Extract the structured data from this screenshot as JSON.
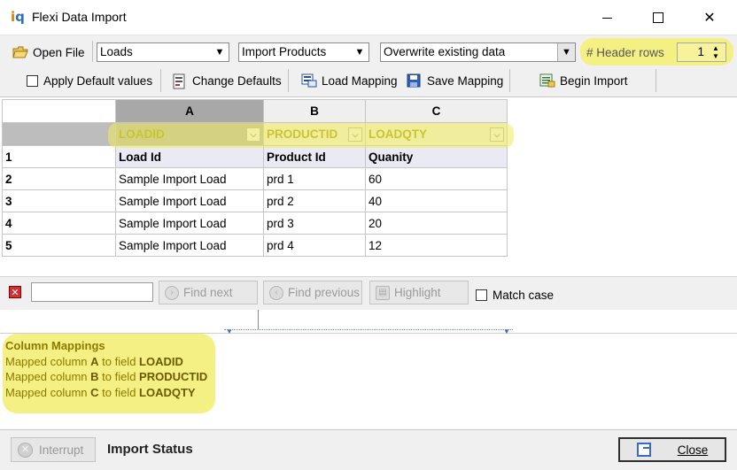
{
  "window": {
    "title": "Flexi Data Import",
    "app_icon_text_1": "i",
    "app_icon_text_2": "q",
    "minimize": "–",
    "close": "✕"
  },
  "toolbar": {
    "open_file_label": "Open File",
    "target_combo_value": "Loads",
    "mapping_combo_value": "Import Products",
    "mode_combo_value": "Overwrite existing data",
    "header_rows_label": "# Header rows",
    "header_rows_value": "1",
    "apply_defaults_label": "Apply Default values",
    "apply_defaults_checked": false,
    "change_defaults_label": "Change Defaults",
    "load_mapping_label": "Load Mapping",
    "save_mapping_label": "Save Mapping",
    "begin_import_label": "Begin Import"
  },
  "grid": {
    "column_letters": [
      "A",
      "B",
      "C"
    ],
    "field_mappings": [
      "LOADID",
      "PRODUCTID",
      "LOADQTY"
    ],
    "dropdown_glyph": "⌵",
    "rows": [
      {
        "num": "1",
        "cells": [
          "Load Id",
          "Product Id",
          "Quanity"
        ]
      },
      {
        "num": "2",
        "cells": [
          "Sample Import Load",
          "prd 1",
          "60"
        ]
      },
      {
        "num": "3",
        "cells": [
          "Sample Import Load",
          "prd 2",
          "40"
        ]
      },
      {
        "num": "4",
        "cells": [
          "Sample Import Load",
          "prd 3",
          "20"
        ]
      },
      {
        "num": "5",
        "cells": [
          "Sample Import Load",
          "prd 4",
          "12"
        ]
      }
    ]
  },
  "search": {
    "error_glyph": "✕",
    "find_next_label": "Find next",
    "find_previous_label": "Find previous",
    "highlight_label": "Highlight",
    "match_case_label": "Match case"
  },
  "log": {
    "title": "Column Mappings",
    "lines": [
      {
        "prefix": "Mapped column ",
        "column": "A",
        "mid": " to field ",
        "field": "LOADID"
      },
      {
        "prefix": "Mapped column ",
        "column": "B",
        "mid": " to field ",
        "field": "PRODUCTID"
      },
      {
        "prefix": "Mapped column ",
        "column": "C",
        "mid": " to field ",
        "field": "LOADQTY"
      }
    ]
  },
  "status": {
    "interrupt_label": "Interrupt",
    "status_label": "Import Status",
    "close_label": "Close"
  },
  "colors": {
    "highlight_yellow": "#f5f084",
    "field_text": "#a09000",
    "accent_blue": "#3a6ac8"
  }
}
